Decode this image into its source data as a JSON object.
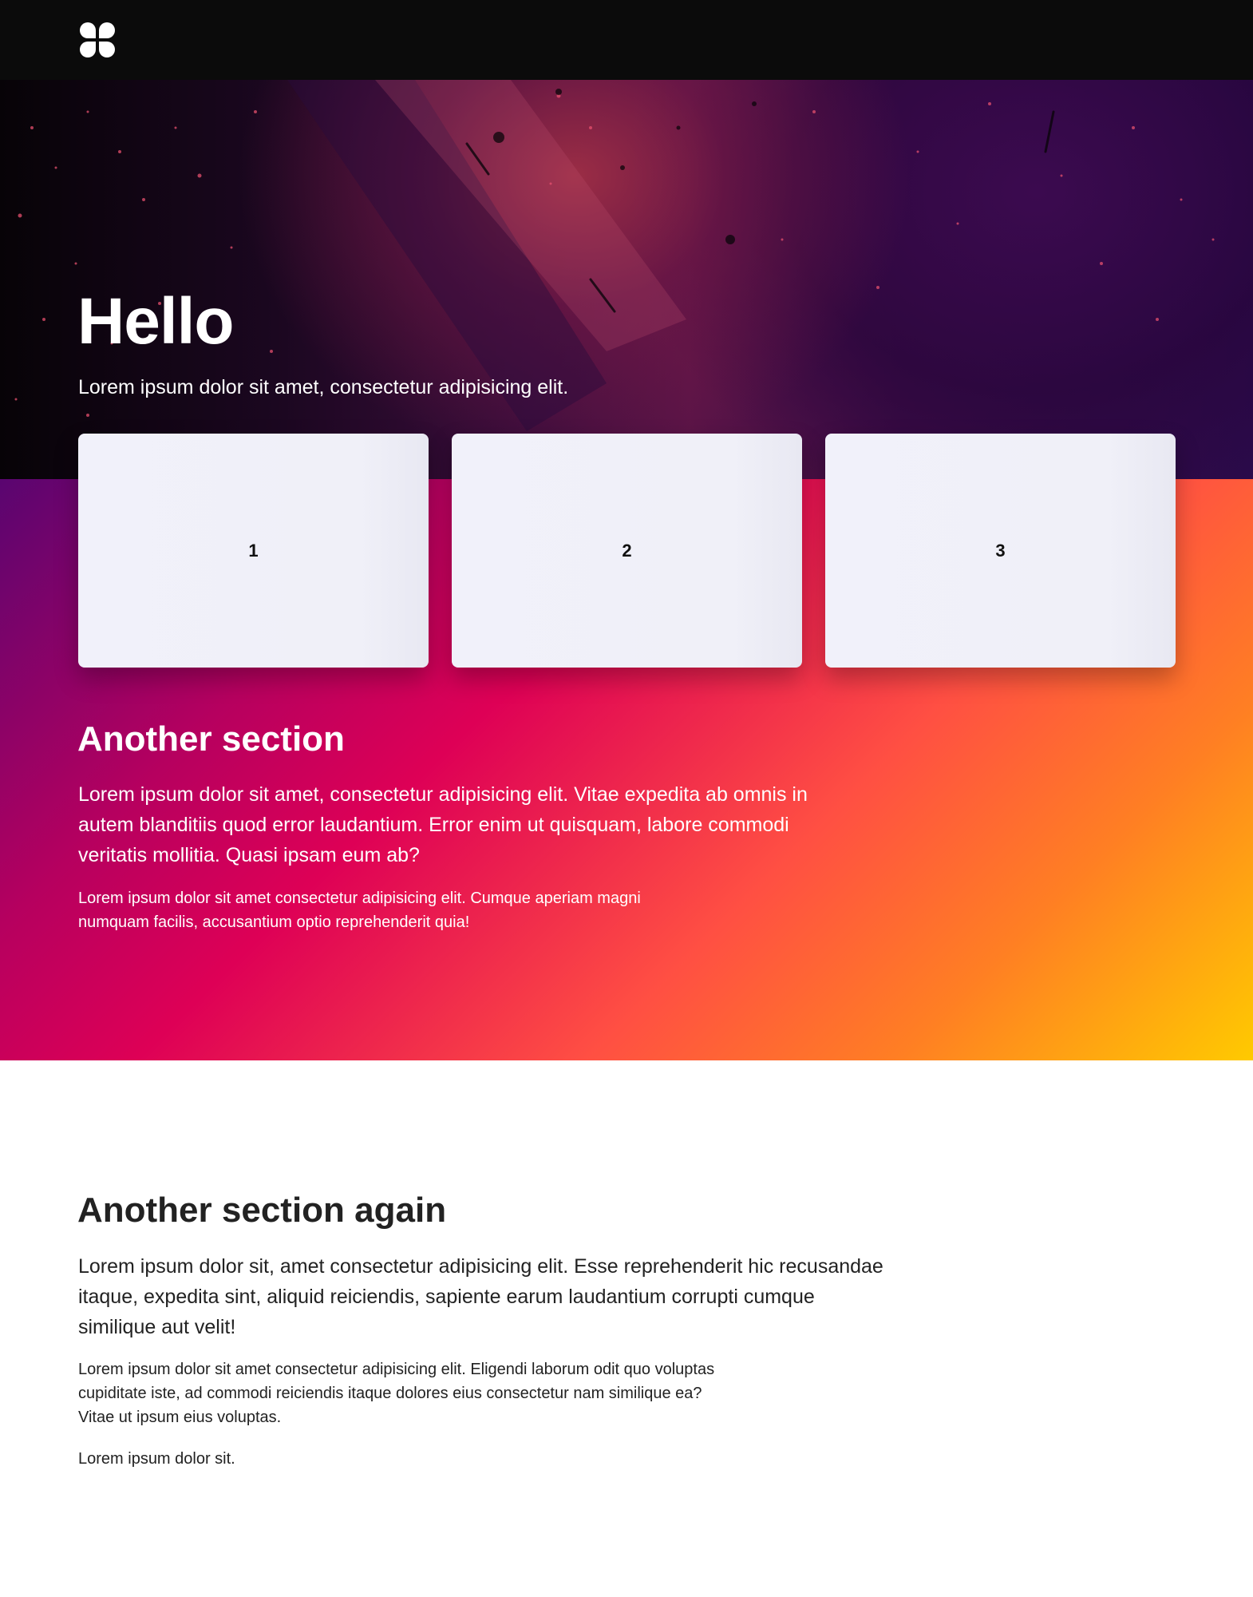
{
  "header": {
    "logo_icon": "four-petal-logo-icon"
  },
  "hero": {
    "title": "Hello",
    "subtitle": "Lorem ipsum dolor sit amet, consectetur adipisicing elit.",
    "cards": [
      {
        "label": "1"
      },
      {
        "label": "2"
      },
      {
        "label": "3"
      }
    ]
  },
  "section_one": {
    "title": "Another section",
    "lead": "Lorem ipsum dolor sit amet, consectetur adipisicing elit. Vitae expedita ab omnis in autem blanditiis quod error laudantium. Error enim ut quisquam, labore commodi veritatis mollitia. Quasi ipsam eum ab?",
    "body": "Lorem ipsum dolor sit amet consectetur adipisicing elit. Cumque aperiam magni numquam facilis, accusantium optio reprehenderit quia!"
  },
  "section_two": {
    "title": "Another section again",
    "lead": "Lorem ipsum dolor sit, amet consectetur adipisicing elit. Esse reprehenderit hic recusandae itaque, expedita sint, aliquid reiciendis, sapiente earum laudantium corrupti cumque similique aut velit!",
    "body": "Lorem ipsum dolor sit amet consectetur adipisicing elit. Eligendi laborum odit quo voluptas cupiditate iste, ad commodi reiciendis itaque dolores eius consectetur nam similique ea? Vitae ut ipsum eius voluptas.",
    "tail": "Lorem ipsum dolor sit."
  },
  "colors": {
    "topbar": "#0b0b0b",
    "card": "#f1f1fa",
    "gradient_start": "#00025a",
    "gradient_mid": "#de0056",
    "gradient_end": "#ffca00"
  }
}
